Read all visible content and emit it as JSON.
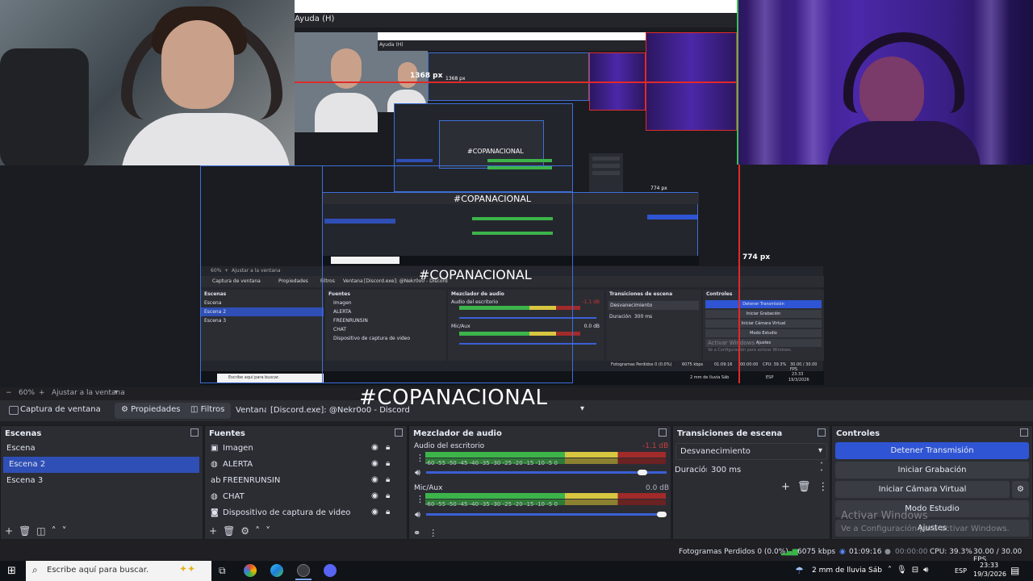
{
  "preview": {
    "menu_text": "Ayuda (H)",
    "nested_menu_text": "Ayuda (H)",
    "px_label_1": "1368 px",
    "px_label_2": "1368 px",
    "px_label_right_1": "774 px",
    "px_label_right_2": "774 px",
    "hashtag_small_1": "#COPANACIONAL",
    "hashtag_small_2": "#COPANACIONAL",
    "hashtag_mid": "#COPANACIONAL",
    "nested_windows_title": "Activar Windows",
    "nested_windows_sub": "Ve a Configuración para activar Windows.",
    "nested_search": "Escribe aquí para buscar.",
    "nested_zoom": "60%",
    "nested_fit": "Ajustar a la ventana",
    "nested_source": "Captura de ventana",
    "nested_props": "Propiedades",
    "nested_filters": "Filtros",
    "nested_window_label": "Ventana",
    "nested_window_value": "[Discord.exe]: @Nekr0o0 - Discord",
    "nested_scenes_header": "Escenas",
    "nested_sources_header": "Fuentes",
    "nested_mixer_header": "Mezclador de audio",
    "nested_transitions_header": "Transiciones de escena",
    "nested_controls_header": "Controles",
    "nested_scenes": [
      "Escena",
      "Escena 2",
      "Escena 3"
    ],
    "nested_sources": [
      "Imagen",
      "ALERTA",
      "FREENRUNSIN",
      "CHAT",
      "Dispositivo de captura de video"
    ],
    "nested_controls": [
      "Detener Transmisión",
      "Iniciar Grabación",
      "Iniciar Cámara Virtual",
      "Modo Estudio",
      "Ajustes"
    ],
    "nested_transition": "Desvanecimiento",
    "nested_duration_label": "Duración",
    "nested_duration": "300 ms",
    "nested_audio1": "Audio del escritorio",
    "nested_audio1_db": "-1.1 dB",
    "nested_audio2": "Mic/Aux",
    "nested_audio2_db": "0.0 dB",
    "nested_status": "Fotogramas Perdidos 0 (0.0%)",
    "nested_kbps": "6075 kbps",
    "nested_time": "01:09:16",
    "nested_rec": "00:00:00",
    "nested_cpu": "CPU: 39.3%",
    "nested_fps": "30.00 / 30.00 FPS",
    "nested_weather": "2 mm de lluvia Sáb",
    "nested_lang": "ESP",
    "nested_clock": "23:33",
    "nested_date": "19/3/2026"
  },
  "toolbar": {
    "zoom": "60%",
    "zoom_plus": "+",
    "zoom_minus": "−",
    "fit": "Ajustar a la ventana"
  },
  "hashtag": "#COPANACIONAL",
  "source_bar": {
    "source_name": "Captura de ventana",
    "properties": "Propiedades",
    "filters": "Filtros",
    "window_label": "Ventana",
    "window_value": "[Discord.exe]: @Nekr0o0 - Discord"
  },
  "scenes": {
    "header": "Escenas",
    "items": [
      "Escena",
      "Escena 2",
      "Escena 3"
    ],
    "selected": "Escena 2"
  },
  "sources": {
    "header": "Fuentes",
    "items": [
      "Imagen",
      "ALERTA",
      "FREENRUNSIN",
      "CHAT",
      "Dispositivo de captura de video"
    ]
  },
  "mixer": {
    "header": "Mezclador de audio",
    "channels": [
      {
        "name": "Audio del escritorio",
        "db": "-1.1 dB",
        "volume": 0.92
      },
      {
        "name": "Mic/Aux",
        "db": "0.0 dB",
        "volume": 1.0
      }
    ],
    "scale": "-60 -55 -50 -45 -40 -35 -30 -25 -20 -15 -10 -5 0"
  },
  "transitions": {
    "header": "Transiciones de escena",
    "selected": "Desvanecimiento",
    "duration_label": "Duración",
    "duration_value": "300 ms"
  },
  "controls": {
    "header": "Controles",
    "stop_stream": "Detener Transmisión",
    "start_recording": "Iniciar Grabación",
    "start_virtual_cam": "Iniciar Cámara Virtual",
    "studio_mode": "Modo Estudio",
    "settings": "Ajustes"
  },
  "watermark": {
    "title": "Activar Windows",
    "subtitle": "Ve a Configuración para activar Windows."
  },
  "status": {
    "dropped": "Fotogramas Perdidos 0 (0.0%)",
    "bitrate": "6075 kbps",
    "stream_time": "01:09:16",
    "rec_time": "00:00:00",
    "cpu": "CPU: 39.3%",
    "fps": "30.00 / 30.00 FPS"
  },
  "taskbar": {
    "search_placeholder": "Escribe aquí para buscar.",
    "weather": "2 mm de lluvia Sáb",
    "language": "ESP",
    "time": "23:33",
    "date": "19/3/2026"
  },
  "colors": {
    "accent": "#2f55d4",
    "selection": "#2f4fb6",
    "meter_green": "#3cb44a",
    "meter_yellow": "#d7c640",
    "meter_red": "#a12a2a",
    "guide_red": "#e02a2a"
  }
}
